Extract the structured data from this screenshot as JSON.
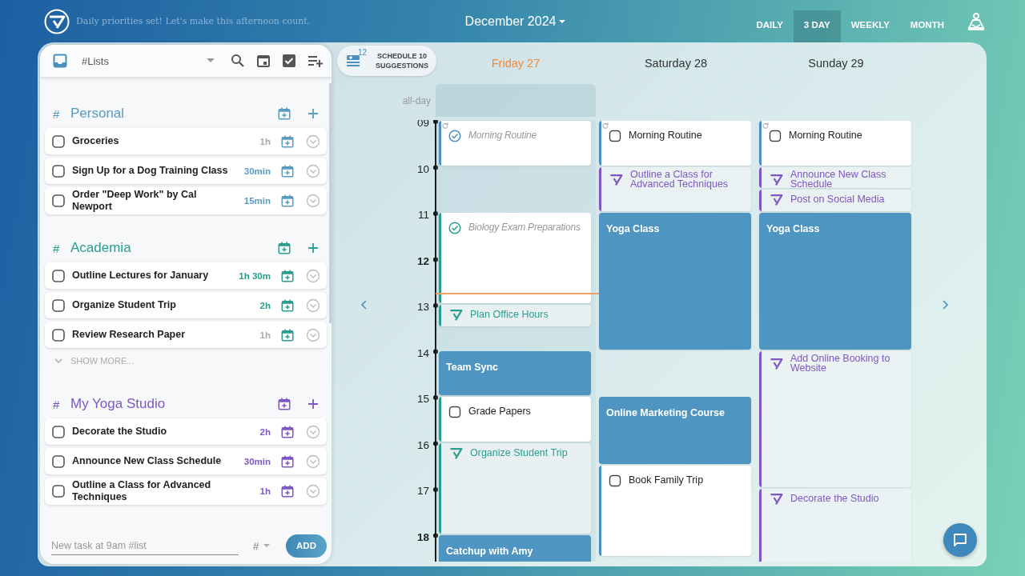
{
  "header": {
    "tagline": "Daily priorities set! Let's make this afternoon count.",
    "month": "December 2024",
    "views": [
      {
        "label": "DAILY",
        "selected": false
      },
      {
        "label": "3 DAY",
        "selected": true
      },
      {
        "label": "WEEKLY",
        "selected": false
      },
      {
        "label": "MONTH",
        "selected": false
      }
    ]
  },
  "sidebar": {
    "list_selector": "#Lists",
    "lists": [
      {
        "prefix": "#",
        "name": "Personal",
        "color": "#5b9bbf",
        "tasks": [
          {
            "title": "Groceries",
            "duration": "1h",
            "dimmed": true,
            "checked": false
          },
          {
            "title": "Sign Up for a Dog Training Class",
            "duration": "30min",
            "dimmed": false,
            "checked": false
          },
          {
            "title": "Order \"Deep Work\" by Cal Newport",
            "duration": "15min",
            "dimmed": false,
            "checked": false
          }
        ]
      },
      {
        "prefix": "#",
        "name": "Academia",
        "color": "#2a9d8f",
        "show_more": "SHOW MORE...",
        "tasks": [
          {
            "title": "Outline Lectures for January",
            "duration": "1h 30m",
            "dimmed": false,
            "checked": false
          },
          {
            "title": "Organize Student Trip",
            "duration": "2h",
            "dimmed": false,
            "checked": false
          },
          {
            "title": "Review Research Paper",
            "duration": "1h",
            "dimmed": true,
            "checked": false
          }
        ]
      },
      {
        "prefix": "#",
        "name": "My Yoga Studio",
        "color": "#7e57c2",
        "tasks": [
          {
            "title": "Decorate the Studio",
            "duration": "2h",
            "dimmed": false,
            "checked": false
          },
          {
            "title": "Announce New Class Schedule",
            "duration": "30min",
            "dimmed": false,
            "checked": false
          },
          {
            "title": "Outline a Class for Advanced Techniques",
            "duration": "1h",
            "dimmed": false,
            "checked": false
          }
        ]
      }
    ],
    "new_task": {
      "placeholder": "New task at 9am #list",
      "list_picker": "#",
      "button": "ADD"
    }
  },
  "calendar": {
    "suggestions": {
      "count": "12",
      "label": "SCHEDULE 10 SUGGESTIONS"
    },
    "all_day_label": "all-day",
    "hours": [
      {
        "label": "09",
        "bold": false
      },
      {
        "label": "10",
        "bold": false
      },
      {
        "label": "11",
        "bold": false
      },
      {
        "label": "12",
        "bold": true
      },
      {
        "label": "13",
        "bold": false
      },
      {
        "label": "14",
        "bold": false
      },
      {
        "label": "15",
        "bold": false
      },
      {
        "label": "16",
        "bold": false
      },
      {
        "label": "17",
        "bold": false
      },
      {
        "label": "18",
        "bold": true
      }
    ],
    "days": [
      {
        "label": "Friday 27",
        "today": true,
        "events": [
          {
            "kind": "task",
            "title": "Morning Routine",
            "checked": true,
            "recurring": true,
            "color": "#4a8fbf"
          },
          {
            "kind": "task",
            "title": "Biology Exam Preparations",
            "checked": true,
            "recurring": false,
            "color": "#2a9d8f"
          },
          {
            "kind": "suggestion",
            "title": "Plan Office Hours",
            "color": "#2a9d8f"
          },
          {
            "kind": "event",
            "title": "Team Sync"
          },
          {
            "kind": "task",
            "title": "Grade Papers",
            "checked": false,
            "recurring": false,
            "color": "#2a9d8f"
          },
          {
            "kind": "suggestion",
            "title": "Organize Student Trip",
            "color": "#2a9d8f"
          },
          {
            "kind": "event",
            "title": "Catchup with Amy"
          }
        ]
      },
      {
        "label": "Saturday 28",
        "today": false,
        "events": [
          {
            "kind": "task",
            "title": "Morning Routine",
            "checked": false,
            "recurring": true,
            "color": "#4a8fbf"
          },
          {
            "kind": "suggestion",
            "title": "Outline a Class for Advanced Techniques",
            "color": "#7e57c2"
          },
          {
            "kind": "event",
            "title": "Yoga Class"
          },
          {
            "kind": "event",
            "title": "Online Marketing Course"
          },
          {
            "kind": "task",
            "title": "Book Family Trip",
            "checked": false,
            "recurring": false,
            "color": "#4a8fbf"
          }
        ]
      },
      {
        "label": "Sunday 29",
        "today": false,
        "events": [
          {
            "kind": "task",
            "title": "Morning Routine",
            "checked": false,
            "recurring": true,
            "color": "#4a8fbf"
          },
          {
            "kind": "suggestion",
            "title": "Announce New Class Schedule",
            "color": "#7e57c2"
          },
          {
            "kind": "suggestion",
            "title": "Post on Social Media",
            "color": "#7e57c2"
          },
          {
            "kind": "event",
            "title": "Yoga Class"
          },
          {
            "kind": "suggestion",
            "title": "Add Online Booking to Website",
            "color": "#7e57c2"
          },
          {
            "kind": "suggestion",
            "title": "Decorate the Studio",
            "color": "#7e57c2"
          }
        ]
      }
    ]
  }
}
